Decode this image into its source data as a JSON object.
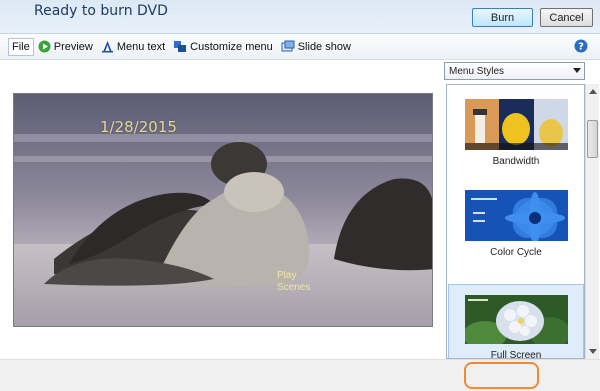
{
  "window": {
    "title": "Ready to burn DVD"
  },
  "toolbar": {
    "file": "File",
    "preview": "Preview",
    "menu_text": "Menu text",
    "customize_menu": "Customize menu",
    "slide_show": "Slide show"
  },
  "preview": {
    "date": "1/28/2015",
    "play": "Play",
    "scenes": "Scenes"
  },
  "styles": {
    "dropdown_value": "Menu Styles",
    "items": [
      {
        "label": "Bandwidth",
        "selected": false
      },
      {
        "label": "Color Cycle",
        "selected": false
      },
      {
        "label": "Full Screen",
        "selected": true
      }
    ]
  },
  "buttons": {
    "burn": "Burn",
    "cancel": "Cancel"
  },
  "colors": {
    "accent": "#f08a35",
    "title": "#1f3b63",
    "date_text": "#e0d79a"
  }
}
